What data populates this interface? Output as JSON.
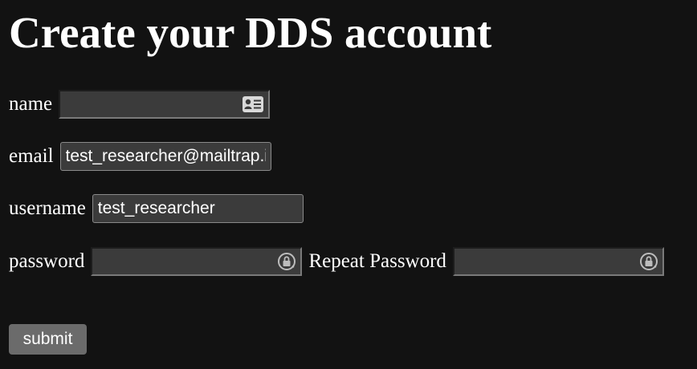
{
  "page": {
    "title": "Create your DDS account"
  },
  "form": {
    "name": {
      "label": "name",
      "value": "",
      "icon": "contact-card-icon"
    },
    "email": {
      "label": "email",
      "value": "test_researcher@mailtrap.io"
    },
    "username": {
      "label": "username",
      "value": "test_researcher"
    },
    "password": {
      "label": "password",
      "value": "",
      "icon": "password-key-icon"
    },
    "repeat_password": {
      "label": "Repeat Password",
      "value": "",
      "icon": "password-key-icon"
    },
    "submit_label": "submit"
  },
  "colors": {
    "background": "#121212",
    "field": "#3b3b3b",
    "button": "#6b6b6b",
    "text": "#ffffff"
  }
}
